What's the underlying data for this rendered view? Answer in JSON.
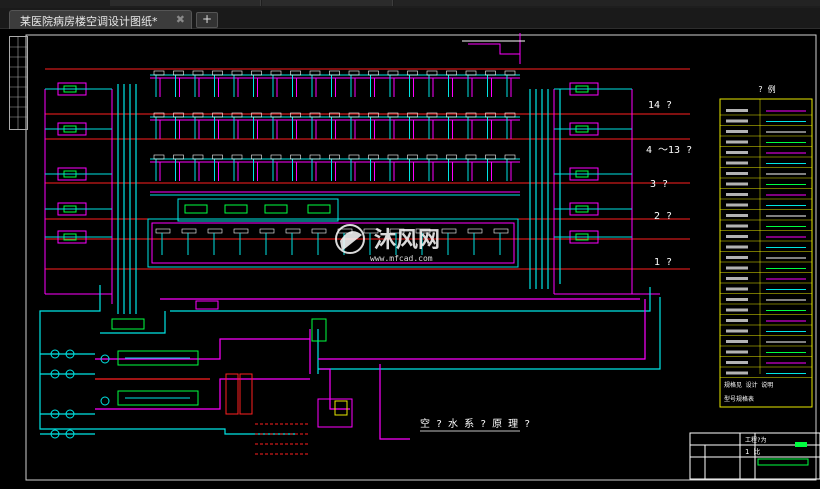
{
  "window": {
    "menu_items": [
      "",
      "",
      ""
    ]
  },
  "tabs": [
    {
      "label": "某医院病房楼空调设计图纸*",
      "close": "✖"
    }
  ],
  "new_tab": "+",
  "drawing": {
    "floor_labels": [
      "14 ?",
      "4 ～13 ?",
      "3 ?",
      "2 ?",
      "1 ?"
    ],
    "caption": "空 ? 水 系 ? 原 理 ?",
    "legend_title": "? 例",
    "legend_footer": [
      "规格见 设计 说明",
      "型号规格表"
    ],
    "title_block_label": "工程?为",
    "title_block_no": "1 比",
    "watermark_cn": "沐风网",
    "watermark_url": "www.mfcad.com"
  },
  "colors": {
    "pipe_cyan": "#00e5e5",
    "pipe_magenta": "#ff00ff",
    "pipe_red": "#ff2020",
    "pipe_yellow": "#e8e800",
    "pipe_green": "#00ff40",
    "pipe_white": "#ffffff",
    "background": "#000000"
  },
  "icons": [
    "close-icon",
    "plus-icon"
  ]
}
